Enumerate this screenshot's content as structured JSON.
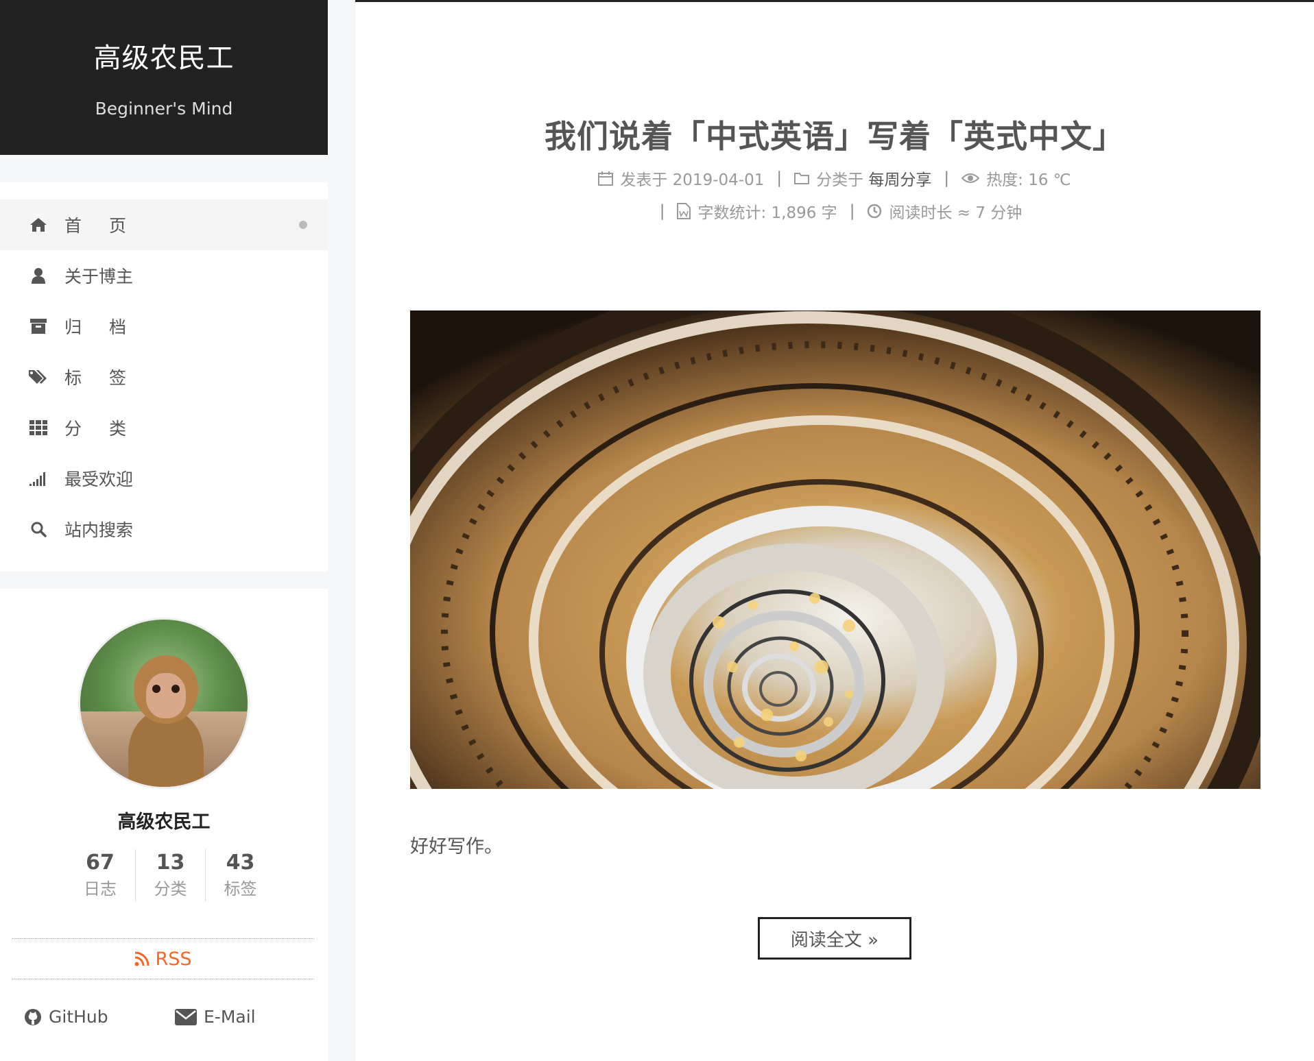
{
  "brand": {
    "title": "高级农民工",
    "subtitle": "Beginner's Mind"
  },
  "menu": [
    {
      "label": "首页",
      "icon": "home-icon"
    },
    {
      "label": "关于博主",
      "icon": "user-icon"
    },
    {
      "label": "归档",
      "icon": "archive-icon"
    },
    {
      "label": "标签",
      "icon": "tags-icon"
    },
    {
      "label": "分类",
      "icon": "grid-icon"
    },
    {
      "label": "最受欢迎",
      "icon": "signal-icon"
    },
    {
      "label": "站内搜索",
      "icon": "search-icon"
    }
  ],
  "profile": {
    "name": "高级农民工",
    "stats": [
      {
        "count": "67",
        "label": "日志"
      },
      {
        "count": "13",
        "label": "分类"
      },
      {
        "count": "43",
        "label": "标签"
      }
    ],
    "rss": "RSS",
    "links": [
      {
        "label": "GitHub"
      },
      {
        "label": "E-Mail"
      }
    ]
  },
  "post": {
    "title": "我们说着「中式英语」写着「英式中文」",
    "meta": {
      "posted": "发表于 2019-04-01",
      "category_prefix": "分类于",
      "category": "每周分享",
      "views": "热度: 16 ℃",
      "wordcount": "字数统计: 1,896 字",
      "readtime": "阅读时长 ≈ 7 分钟",
      "separator": "|"
    },
    "excerpt": "好好写作。",
    "read_more": "阅读全文 »"
  },
  "colors": {
    "header_bg": "#222222",
    "rss": "#fc6423",
    "accent_text": "#555555"
  }
}
